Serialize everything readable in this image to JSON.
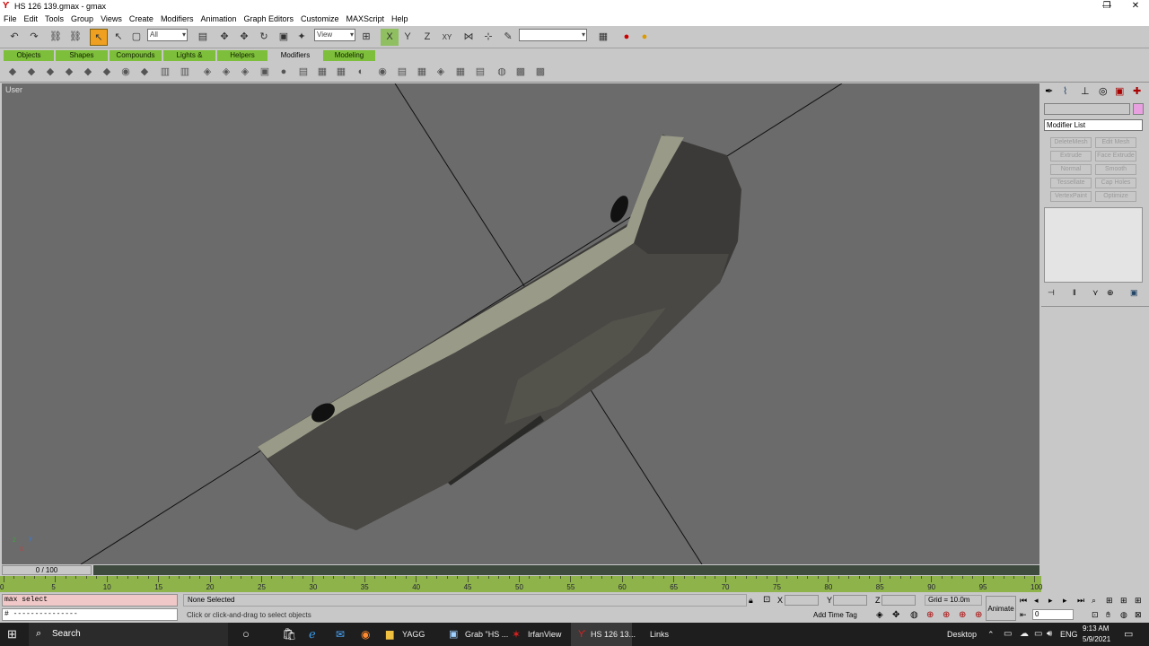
{
  "window": {
    "title": "HS 126 139.gmax - gmax",
    "minimize": "—",
    "restore": "❐",
    "close": "✕"
  },
  "menu": [
    "File",
    "Edit",
    "Tools",
    "Group",
    "Views",
    "Create",
    "Modifiers",
    "Animation",
    "Graph Editors",
    "Customize",
    "MAXScript",
    "Help"
  ],
  "toolbar": {
    "selection_filter": "All",
    "ref_coord": "View",
    "named_sel": ""
  },
  "tabs": [
    "Objects",
    "Shapes",
    "Compounds",
    "Lights & Cameras",
    "Helpers",
    "Modifiers",
    "Modeling"
  ],
  "viewport": {
    "label": "User",
    "axis_x": "x",
    "axis_y": "y",
    "axis_z": "z"
  },
  "command_panel": {
    "name_field": "",
    "modifier_list": "Modifier List",
    "buttons": [
      "DeleteMesh",
      "Edit Mesh",
      "Extrude",
      "Face Extrude",
      "Normal",
      "Smooth",
      "Tessellate",
      "Cap Holes",
      "VertexPaint",
      "Optimize"
    ]
  },
  "timeline": {
    "slider": "0 / 100",
    "ticks": [
      "0",
      "5",
      "10",
      "15",
      "20",
      "25",
      "30",
      "35",
      "40",
      "45",
      "50",
      "55",
      "60",
      "65",
      "70",
      "75",
      "80",
      "85",
      "90",
      "95",
      "100"
    ]
  },
  "status": {
    "listener_line1": "max select",
    "listener_line2": "# ---------------",
    "selection": "None Selected",
    "prompt": "Click or click-and-drag to select objects",
    "x_label": "X",
    "y_label": "Y",
    "z_label": "Z",
    "x_val": "",
    "y_val": "",
    "z_val": "",
    "grid": "Grid = 10.0m",
    "add_time_tag": "Add Time Tag",
    "animate": "Animate",
    "frame": "0"
  },
  "taskbar": {
    "search": "Search",
    "apps": [
      "YAGG",
      "Grab \"HS ...",
      "IrfanView",
      "HS 126 13..."
    ],
    "links": "Links",
    "desktop": "Desktop",
    "lang": "ENG",
    "time": "9:13 AM",
    "date": "5/9/2021"
  },
  "colors": {
    "accent": "#7dbf3a",
    "viewport_bg": "#6b6b6b",
    "active_tool": "#f0a020"
  }
}
